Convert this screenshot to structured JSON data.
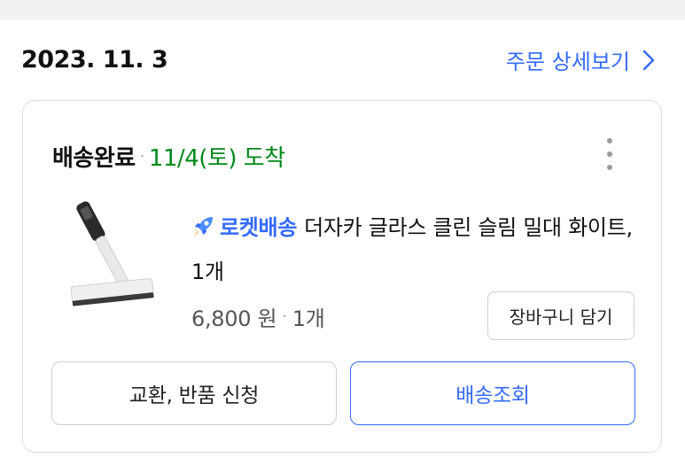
{
  "order": {
    "date": "2023. 11. 3",
    "detail_link_label": "주문 상세보기"
  },
  "card": {
    "status": "배송완료",
    "separator": "·",
    "arrival": "11/4(토) 도착",
    "product": {
      "badge": "로켓배송",
      "name": "더자카 글라스 클린 슬림 밀대 화이트, 1개",
      "price": "6,800 원",
      "separator": "·",
      "quantity": "1개"
    },
    "cart_button_label": "장바구니 담기",
    "return_button_label": "교환, 반품 신청",
    "tracking_button_label": "배송조회"
  },
  "colors": {
    "accent": "#346aff",
    "status_green": "#00891a",
    "border": "#dedede"
  },
  "icons": {
    "detail_link": "chevron-right-icon",
    "more": "more-vertical-icon",
    "badge": "rocket-icon"
  }
}
